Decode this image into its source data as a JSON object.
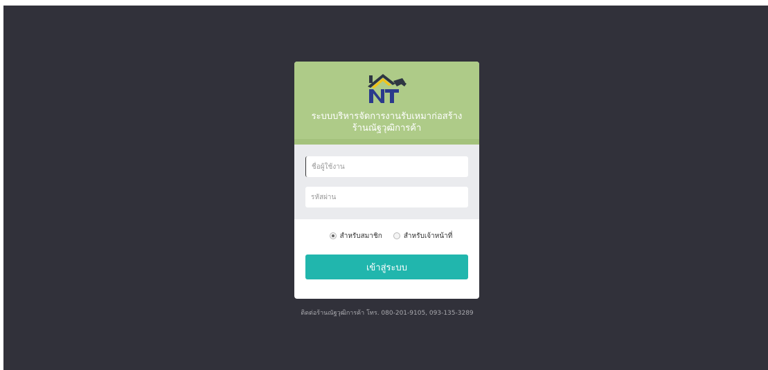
{
  "header": {
    "title_line1": "ระบบบริหารจัดการงานรับเหมาก่อสร้าง",
    "title_line2": "ร้านณัฐวุฒิการค้า",
    "logo_icon": "house-hammer-nt-logo"
  },
  "form": {
    "username_placeholder": "ชื่อผู้ใช้งาน",
    "username_value": "",
    "password_placeholder": "รหัสผ่าน",
    "password_value": ""
  },
  "roles": {
    "member_label": "สำหรับสมาชิก",
    "staff_label": "สำหรับเจ้าหน้าที่",
    "selected": "member"
  },
  "login_button_label": "เข้าสู่ระบบ",
  "footer": {
    "contact": "ติดต่อร้านณัฐวุฒิการค้า โทร. 080-201-9105, 093-135-3289"
  },
  "colors": {
    "background": "#31313a",
    "header": "#aecb88",
    "form_area": "#eaebee",
    "button": "#21b6ad"
  }
}
